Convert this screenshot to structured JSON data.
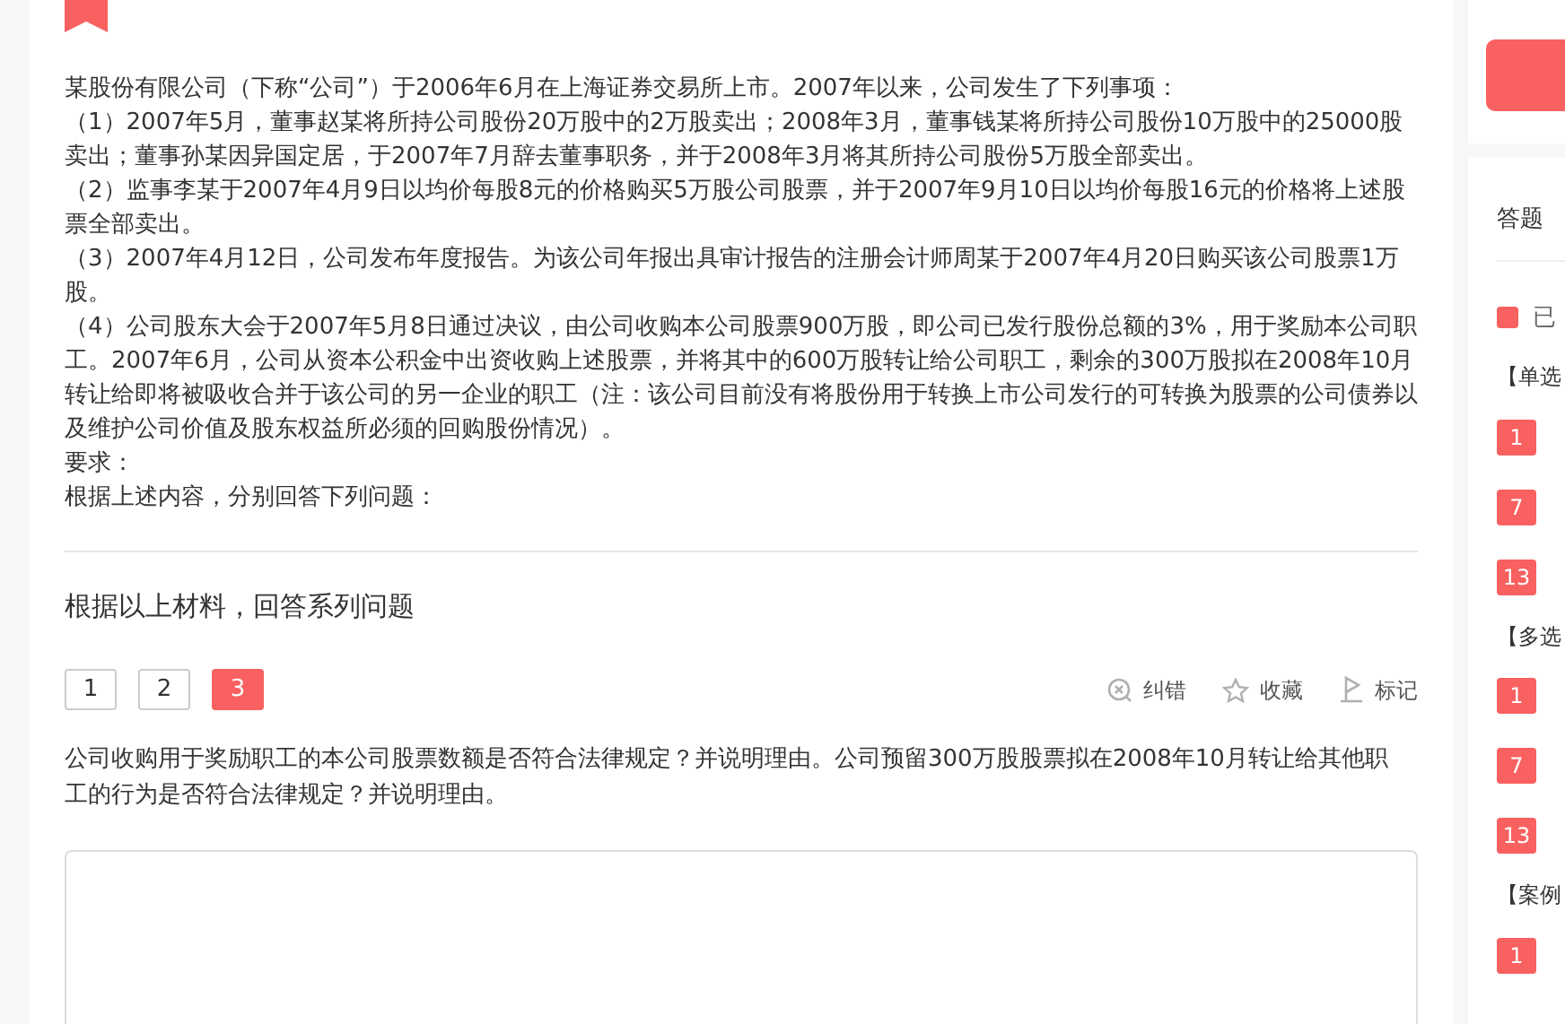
{
  "material": {
    "paragraphs": [
      "某股份有限公司（下称“公司”）于2006年6月在上海证券交易所上市。2007年以来，公司发生了下列事项：",
      "（1）2007年5月，董事赵某将所持公司股份20万股中的2万股卖出；2008年3月，董事钱某将所持公司股份10万股中的25000股卖出；董事孙某因异国定居，于2007年7月辞去董事职务，并于2008年3月将其所持公司股份5万股全部卖出。",
      "（2）监事李某于2007年4月9日以均价每股8元的价格购买5万股公司股票，并于2007年9月10日以均价每股16元的价格将上述股票全部卖出。",
      "（3）2007年4月12日，公司发布年度报告。为该公司年报出具审计报告的注册会计师周某于2007年4月20日购买该公司股票1万股。",
      "（4）公司股东大会于2007年5月8日通过决议，由公司收购本公司股票900万股，即公司已发行股份总额的3%，用于奖励本公司职工。2007年6月，公司从资本公积金中出资收购上述股票，并将其中的600万股转让给公司职工，剩余的300万股拟在2008年10月转让给即将被吸收合并于该公司的另一企业的职工（注：该公司目前没有将股份用于转换上市公司发行的可转换为股票的公司债券以及维护公司价值及股东权益所必须的回购股份情况）。",
      "要求：",
      "根据上述内容，分别回答下列问题："
    ]
  },
  "section_title": "根据以上材料，回答系列问题",
  "question_tabs": [
    {
      "label": "1",
      "selected": false
    },
    {
      "label": "2",
      "selected": false
    },
    {
      "label": "3",
      "selected": true
    }
  ],
  "tools": [
    {
      "kind": "report",
      "label": "纠错"
    },
    {
      "kind": "favorite",
      "label": "收藏"
    },
    {
      "kind": "mark",
      "label": "标记"
    }
  ],
  "question": "公司收购用于奖励职工的本公司股票数额是否符合法律规定？并说明理由。公司预留300万股股票拟在2008年10月转让给其他职工的行为是否符合法律规定？并说明理由。",
  "sidebar": {
    "title": "答题",
    "legend": "已",
    "groups": [
      {
        "title": "【单选",
        "items": [
          "1",
          "7",
          "13"
        ]
      },
      {
        "title": "【多选",
        "items": [
          "1",
          "7",
          "13"
        ]
      },
      {
        "title": "【案例",
        "items": [
          "1"
        ]
      }
    ]
  }
}
